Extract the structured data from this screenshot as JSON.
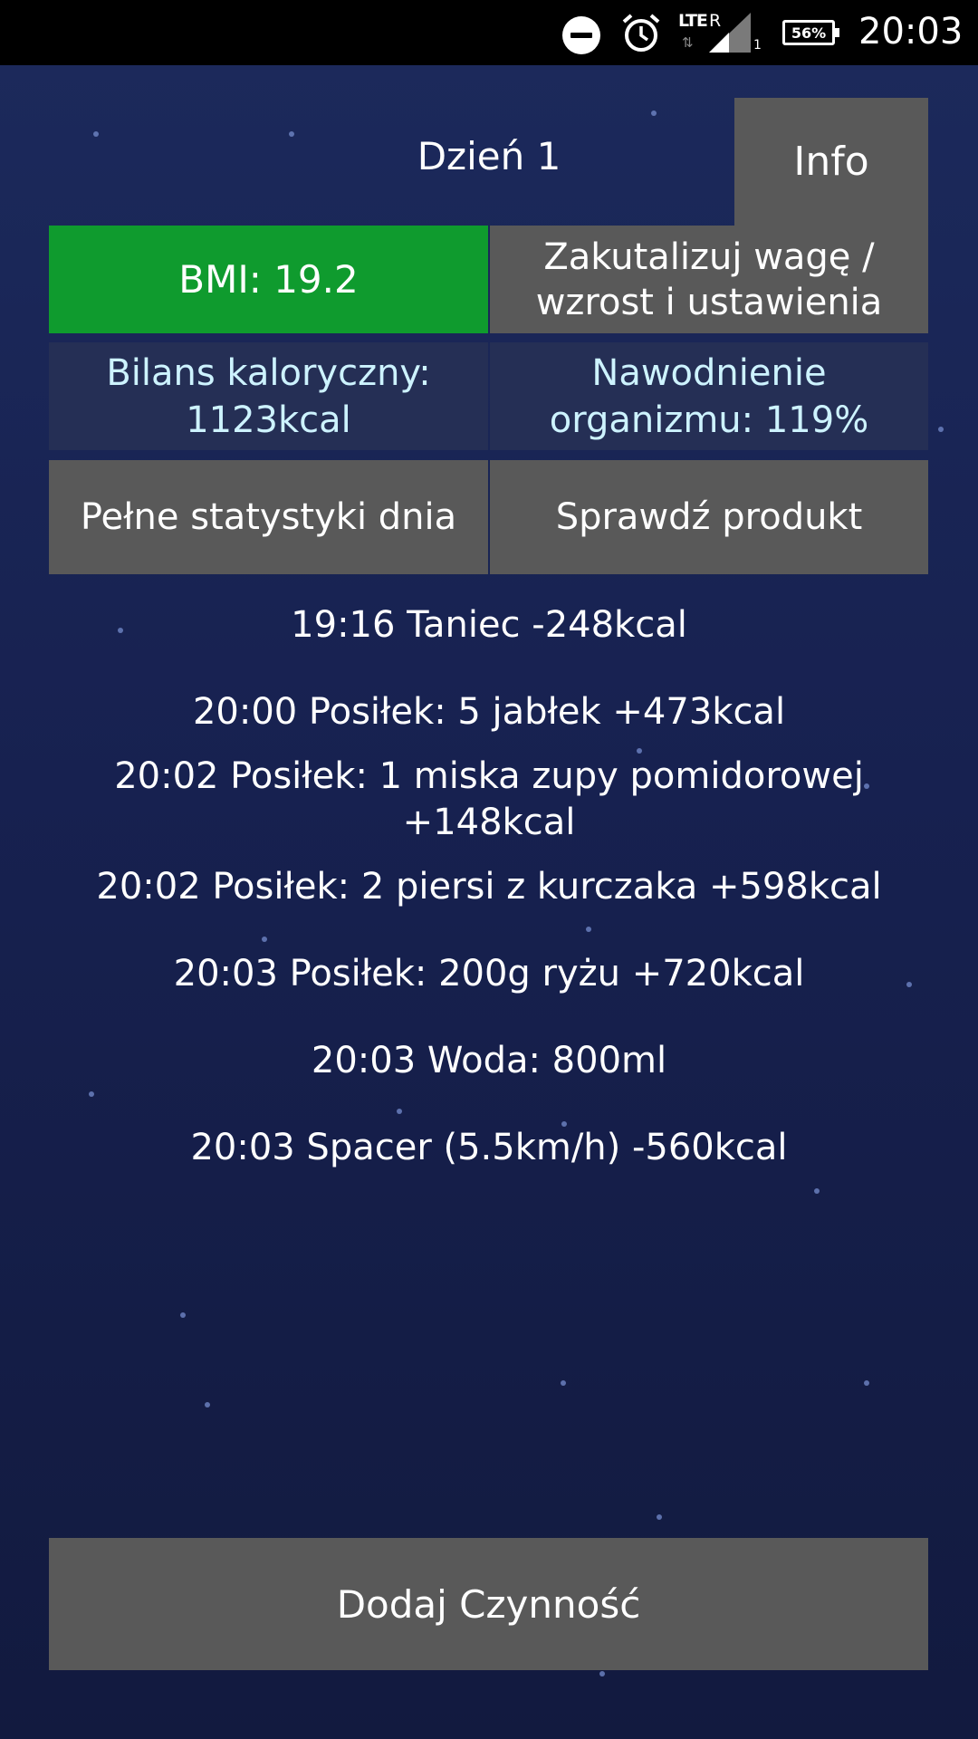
{
  "status_bar": {
    "icons": [
      "do-not-disturb-icon",
      "alarm-icon",
      "lte-signal-icon",
      "battery-icon"
    ],
    "network": "LTE",
    "roaming": "R",
    "sim_slot": "1",
    "battery_percent": "56%",
    "time": "20:03"
  },
  "header": {
    "day_title": "Dzień 1",
    "info_label": "Info"
  },
  "stats": {
    "bmi": "BMI: 19.2",
    "update_button": "Zakutalizuj wagę / wzrost i ustawienia",
    "calorie_balance": "Bilans kaloryczny: 1123kcal",
    "hydration": "Nawodnienie organizmu: 119%",
    "full_stats_button": "Pełne statystyki dnia",
    "check_product_button": "Sprawdź produkt"
  },
  "log": [
    "19:16 Taniec -248kcal",
    "20:00 Posiłek: 5 jabłek +473kcal",
    "20:02 Posiłek: 1 miska zupy pomidorowej +148kcal",
    "20:02 Posiłek: 2 piersi z kurczaka +598kcal",
    "20:03 Posiłek: 200g ryżu +720kcal",
    "20:03 Woda: 800ml",
    "20:03 Spacer (5.5km/h) -560kcal"
  ],
  "add_activity_button": "Dodaj Czynność",
  "colors": {
    "background": "#1a2554",
    "bmi_green": "#0f9b2e",
    "button_gray": "#595959",
    "info_text": "#cdf3ff"
  }
}
